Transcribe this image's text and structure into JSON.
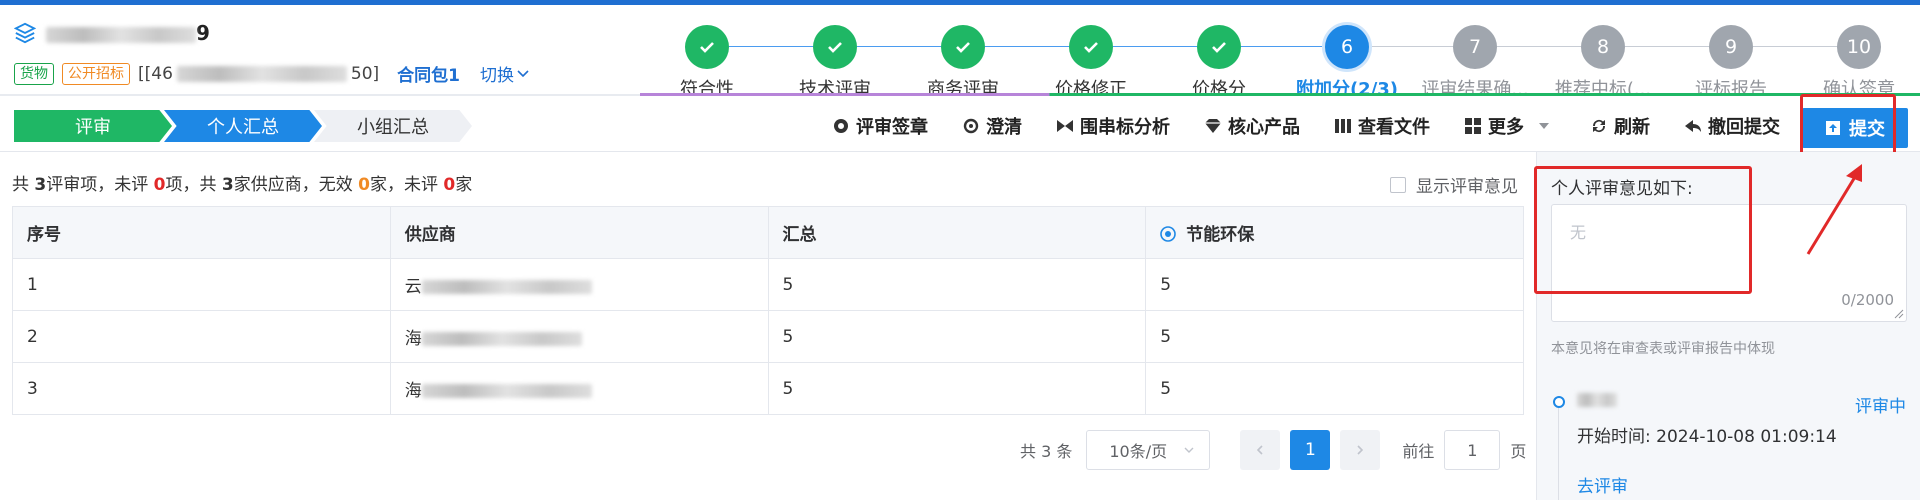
{
  "colors": {
    "primary": "#1e88e5",
    "success": "#1fb765",
    "danger": "#e12929",
    "warning": "#f08a24"
  },
  "header": {
    "title_suffix": "9",
    "tag_goods": "货物",
    "tag_tender": "公开招标",
    "code_prefix": "[[46",
    "code_suffix": "50]",
    "contract": "合同包1",
    "switch": "切换"
  },
  "steps": [
    {
      "num": "",
      "label": "符合性",
      "state": "done"
    },
    {
      "num": "",
      "label": "技术评审",
      "state": "done"
    },
    {
      "num": "",
      "label": "商务评审",
      "state": "done"
    },
    {
      "num": "",
      "label": "价格修正",
      "state": "done"
    },
    {
      "num": "",
      "label": "价格分",
      "state": "done"
    },
    {
      "num": "6",
      "label": "附加分(2/3)",
      "state": "active"
    },
    {
      "num": "7",
      "label": "评审结果确...",
      "state": "todo"
    },
    {
      "num": "8",
      "label": "推荐中标(...",
      "state": "todo"
    },
    {
      "num": "9",
      "label": "评标报告",
      "state": "todo"
    },
    {
      "num": "10",
      "label": "确认签章",
      "state": "todo"
    }
  ],
  "crumbs": [
    "评审",
    "个人汇总",
    "小组汇总"
  ],
  "toolbar": {
    "sign": "评审签章",
    "clarify": "澄清",
    "collusion": "围串标分析",
    "core": "核心产品",
    "files": "查看文件",
    "more": "更多",
    "refresh": "刷新",
    "withdraw": "撤回提交",
    "submit": "提交"
  },
  "summary": {
    "p1": "共 ",
    "n1": "3",
    "p2": "评审项，未评 ",
    "n2": "0",
    "p3": "项，共 ",
    "n3": "3",
    "p4": "家供应商，无效 ",
    "n4": "0",
    "p5": "家，未评 ",
    "n5": "0",
    "p6": "家"
  },
  "show_opinion": "显示评审意见",
  "table": {
    "headers": [
      "序号",
      "供应商",
      "汇总",
      "节能环保"
    ],
    "rows": [
      {
        "no": "1",
        "supplier_prefix": "云",
        "total": "5",
        "score": "5"
      },
      {
        "no": "2",
        "supplier_prefix": "海",
        "total": "5",
        "score": "5"
      },
      {
        "no": "3",
        "supplier_prefix": "海",
        "total": "5",
        "score": "5"
      }
    ]
  },
  "pager": {
    "total": "共 3 条",
    "size": "10条/页",
    "page": "1",
    "goto": "前往",
    "goto_value": "1",
    "page_unit": "页"
  },
  "panel": {
    "title": "个人评审意见如下:",
    "placeholder": "无",
    "count": "0/2000",
    "note": "本意见将在审查表或评审报告中体现",
    "status": "评审中",
    "time_label": "开始时间:",
    "time_value": "2024-10-08 01:09:14",
    "link": "去评审"
  }
}
